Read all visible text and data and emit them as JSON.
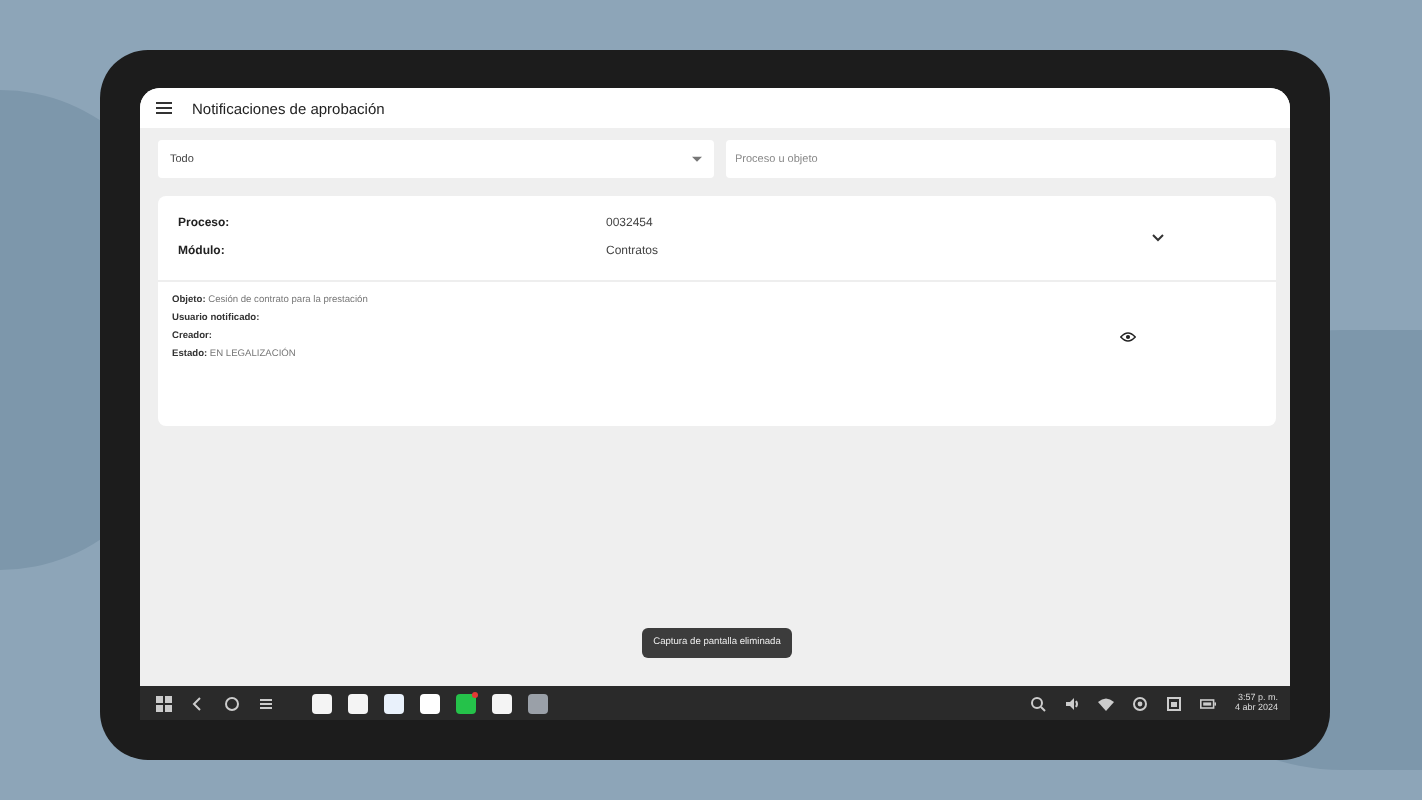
{
  "app_bar": {
    "title": "Notificaciones de aprobación"
  },
  "filters": {
    "status_dropdown": {
      "value": "Todo"
    },
    "search": {
      "placeholder": "Proceso u objeto"
    }
  },
  "notifications": [
    {
      "expanded": true,
      "fields": [
        {
          "label": "Proceso:",
          "value": "0032454"
        },
        {
          "label": "Módulo:",
          "value": "Contratos"
        }
      ],
      "details": [
        {
          "label": "Objeto:",
          "value": "Cesión de contrato para la prestación"
        },
        {
          "label": "Usuario notificado:"
        },
        {
          "label": "Creador:"
        },
        {
          "label": "Estado:",
          "value": "EN LEGALIZACIÓN"
        }
      ]
    }
  ],
  "toast": {
    "text": "Captura de pantalla eliminada"
  },
  "taskbar": {
    "apps": [
      {
        "badge": false
      },
      {
        "badge": false
      },
      {
        "badge": false
      },
      {
        "badge": false
      },
      {
        "badge": true
      },
      {
        "badge": false
      },
      {
        "badge": false
      }
    ],
    "time": "3:57 p. m.",
    "date": "4 abr 2024"
  }
}
